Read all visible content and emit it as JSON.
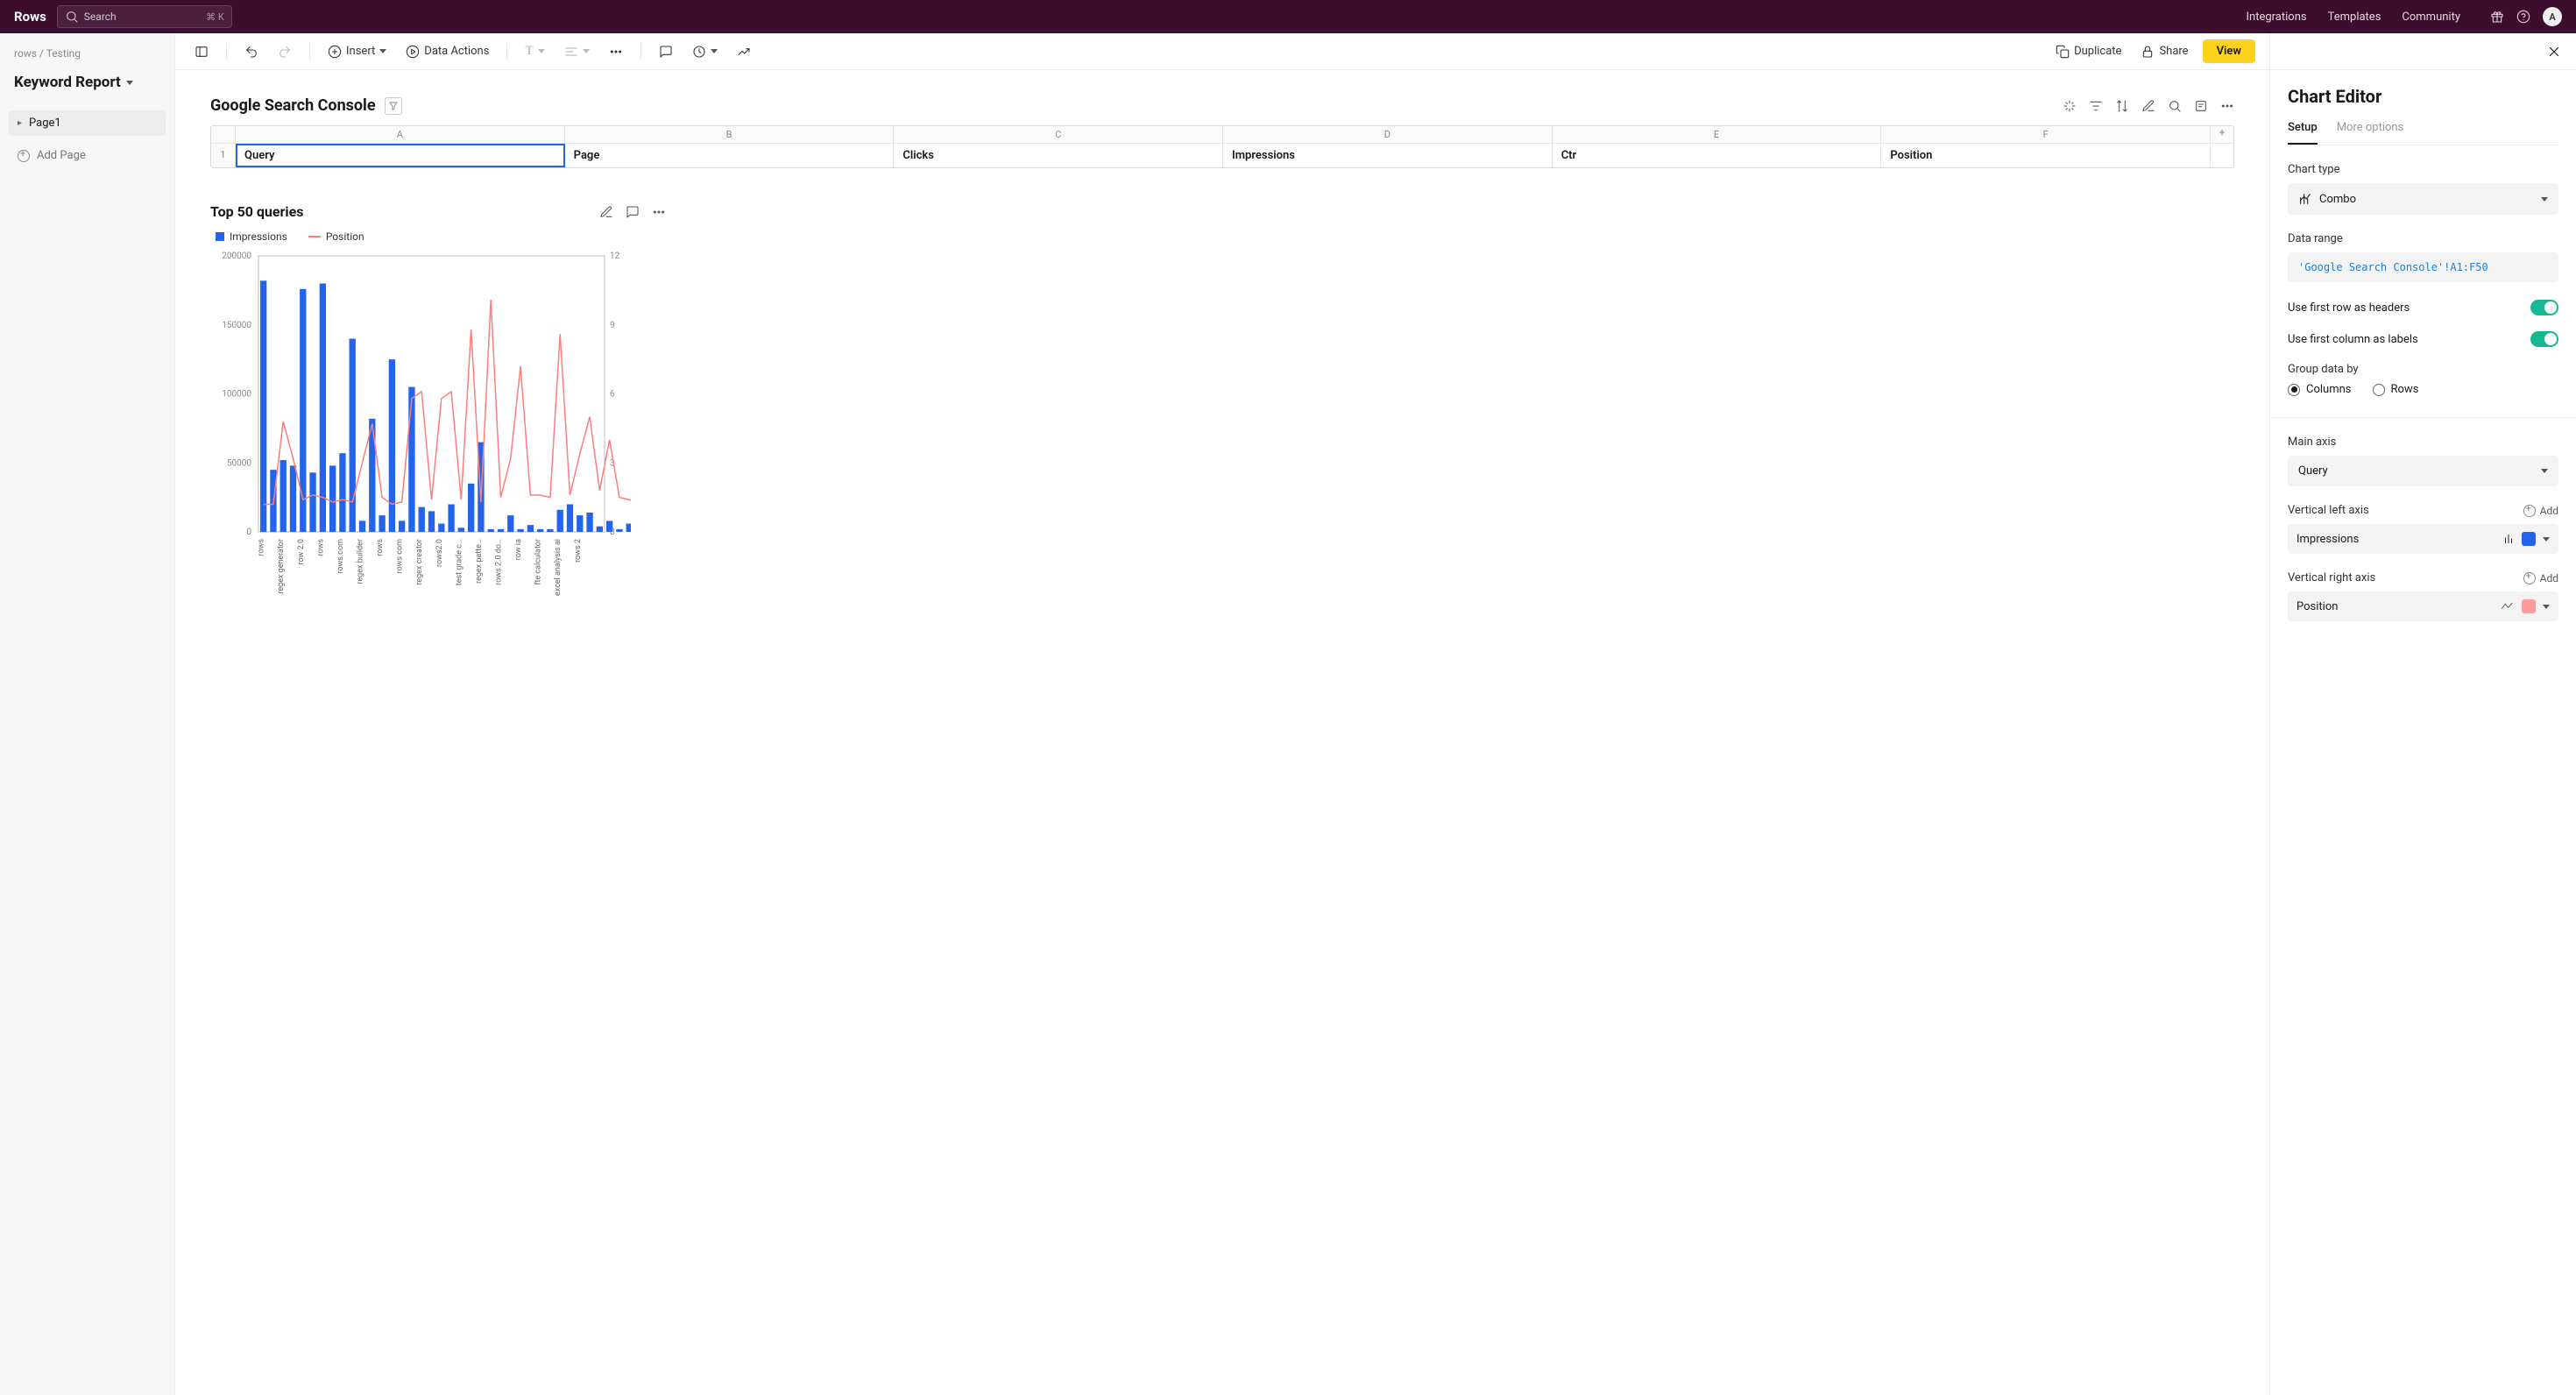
{
  "header": {
    "logo": "Rows",
    "search_placeholder": "Search",
    "search_kbd": "⌘ K",
    "nav": {
      "integrations": "Integrations",
      "templates": "Templates",
      "community": "Community"
    },
    "avatar_initial": "A"
  },
  "sidebar": {
    "breadcrumb_root": "rows",
    "breadcrumb_sep": " / ",
    "breadcrumb_current": "Testing",
    "doc_title": "Keyword Report",
    "page1": "Page1",
    "add_page": "Add Page"
  },
  "toolbar": {
    "insert": "Insert",
    "data_actions": "Data Actions",
    "duplicate": "Duplicate",
    "share": "Share",
    "view": "View"
  },
  "table": {
    "title": "Google Search Console",
    "cols": [
      "A",
      "B",
      "C",
      "D",
      "E",
      "F"
    ],
    "row1_num": "1",
    "headers": [
      "Query",
      "Page",
      "Clicks",
      "Impressions",
      "Ctr",
      "Position"
    ],
    "addcol": "+"
  },
  "chart": {
    "title": "Top 50 queries",
    "legend_impressions": "Impressions",
    "legend_position": "Position"
  },
  "editor": {
    "title": "Chart Editor",
    "tab_setup": "Setup",
    "tab_more": "More options",
    "chart_type_label": "Chart type",
    "chart_type_value": "Combo",
    "data_range_label": "Data range",
    "data_range_value": "'Google Search Console'!A1:F50",
    "first_row_headers": "Use first row as headers",
    "first_col_labels": "Use first column as labels",
    "group_by_label": "Group data by",
    "group_columns": "Columns",
    "group_rows": "Rows",
    "main_axis_label": "Main axis",
    "main_axis_value": "Query",
    "vleft_label": "Vertical left axis",
    "vleft_value": "Impressions",
    "vright_label": "Vertical right axis",
    "vright_value": "Position",
    "add": "Add"
  },
  "chart_data": {
    "type": "combo",
    "title": "Top 50 queries",
    "y_left": {
      "label": "Impressions",
      "min": 0,
      "max": 200000,
      "ticks": [
        0,
        50000,
        100000,
        150000,
        200000
      ]
    },
    "y_right": {
      "label": "Position",
      "min": 0,
      "max": 12,
      "ticks": [
        0,
        3,
        6,
        9,
        12
      ]
    },
    "categories": [
      "rows",
      "",
      "regex generator",
      "",
      "row 2.0",
      "",
      "rows",
      "",
      "rows.com",
      "",
      "regex builder",
      "",
      "rows",
      "",
      "rows com",
      "",
      "regex creator",
      "",
      "rows2.0",
      "",
      "test grade c…",
      "",
      "regex patte…",
      "",
      "rows 2.0 do…",
      "",
      "row ia",
      "",
      "fte calculator",
      "",
      "excel analysis ai",
      "",
      "rows 2",
      "",
      ""
    ],
    "series": [
      {
        "name": "Impressions",
        "type": "bar",
        "color": "#2463eb",
        "values": [
          182000,
          45000,
          52000,
          48000,
          176000,
          43000,
          180000,
          48000,
          57000,
          140000,
          8000,
          82000,
          12000,
          125000,
          8000,
          105000,
          18000,
          15000,
          6000,
          20000,
          3000,
          35000,
          65000,
          2000,
          2000,
          12000,
          2000,
          5000,
          2000,
          2000,
          16000,
          20000,
          12000,
          14000,
          4000,
          8000,
          2000,
          6000,
          2000
        ]
      },
      {
        "name": "Position",
        "type": "line",
        "color": "#ff7d7d",
        "values": [
          1.2,
          1.2,
          4.8,
          3.2,
          1.4,
          1.6,
          1.5,
          1.3,
          1.4,
          1.3,
          3.0,
          4.7,
          1.5,
          1.2,
          1.3,
          5.8,
          6.1,
          1.4,
          5.8,
          6.1,
          1.4,
          8.8,
          1.3,
          10.1,
          1.5,
          3.2,
          7.2,
          1.6,
          1.6,
          1.5,
          8.6,
          1.6,
          3.4,
          5.0,
          1.8,
          4.0,
          1.5,
          1.4,
          1.3
        ]
      }
    ],
    "sparse_x_labels": [
      "rows",
      "regex generator",
      "row 2.0",
      "rows",
      "rows.com",
      "regex builder",
      "rows",
      "rows com",
      "regex creator",
      "rows2.0",
      "test grade c…",
      "regex patte…",
      "rows 2.0 do…",
      "row ia",
      "fte calculator",
      "excel analysis ai",
      "rows 2"
    ]
  }
}
